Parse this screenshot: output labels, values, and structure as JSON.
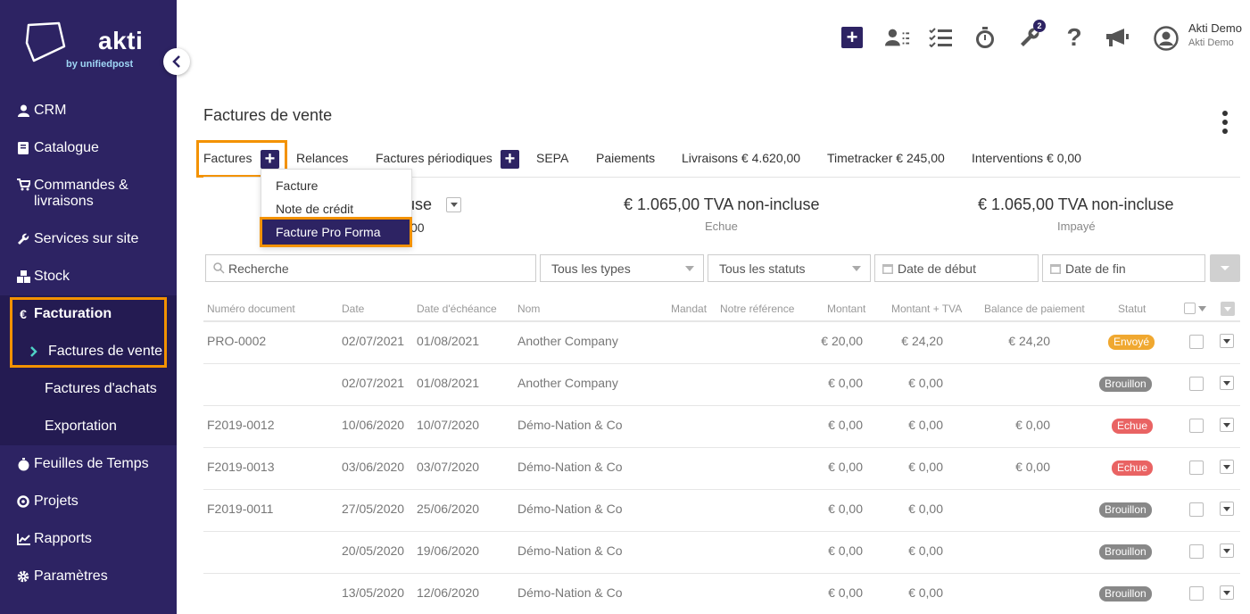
{
  "brand": {
    "name": "akti",
    "subtitle": "by unifiedpost"
  },
  "colors": {
    "sidebar": "#2d2363",
    "accent_highlight": "#f39200",
    "sent": "#f0a830",
    "draft": "#888888",
    "overdue": "#e96363"
  },
  "sidebar": {
    "items": [
      {
        "label": "CRM",
        "icon": "user-icon"
      },
      {
        "label": "Catalogue",
        "icon": "book-icon"
      },
      {
        "label": "Commandes &",
        "label2": "livraisons",
        "icon": "cart-icon"
      },
      {
        "label": "Services sur site",
        "icon": "wrench-icon"
      },
      {
        "label": "Stock",
        "icon": "boxes-icon"
      },
      {
        "label": "Facturation",
        "icon": "euro-icon"
      },
      {
        "label": "Feuilles de Temps",
        "icon": "stopwatch-icon"
      },
      {
        "label": "Projets",
        "icon": "target-icon"
      },
      {
        "label": "Rapports",
        "icon": "chart-icon"
      },
      {
        "label": "Paramètres",
        "icon": "gear-icon"
      }
    ],
    "billing_sub": [
      {
        "label": "Factures de vente"
      },
      {
        "label": "Factures d'achats"
      },
      {
        "label": "Exportation"
      }
    ]
  },
  "topbar": {
    "notifications_count": "2",
    "user_name": "Akti Demo",
    "user_org": "Akti Demo"
  },
  "page": {
    "title": "Factures de vente"
  },
  "tabs": [
    {
      "label": "Factures"
    },
    {
      "label": "Relances"
    },
    {
      "label": "Factures périodiques"
    },
    {
      "label": "SEPA"
    },
    {
      "label": "Paiements"
    },
    {
      "label": "Livraisons € 4.620,00"
    },
    {
      "label": "Timetracker € 245,00"
    },
    {
      "label": "Interventions € 0,00"
    }
  ],
  "dropdown": {
    "items": [
      "Facture",
      "Note de crédit",
      "Facture Pro Forma"
    ]
  },
  "summary": {
    "first_partial": "use",
    "first_partial_sub": "00",
    "overdue_value": "€ 1.065,00 TVA non-incluse",
    "overdue_label": "Echue",
    "unpaid_value": "€ 1.065,00 TVA non-incluse",
    "unpaid_label": "Impayé"
  },
  "filters": {
    "search_placeholder": "Recherche",
    "types": "Tous les types",
    "statuses": "Tous les statuts",
    "start_date": "Date de début",
    "end_date": "Date de fin"
  },
  "table": {
    "headers": [
      "Numéro document",
      "Date",
      "Date d'échéance",
      "Nom",
      "Mandat",
      "Notre référence",
      "Montant",
      "Montant + TVA",
      "Balance de paiement",
      "Statut"
    ],
    "rows": [
      {
        "doc": "PRO-0002",
        "date": "02/07/2021",
        "due": "01/08/2021",
        "name": "Another Company",
        "amount": "€ 20,00",
        "amount_vat": "€ 24,20",
        "balance": "€ 24,20",
        "status": "Envoyé",
        "status_type": "sent"
      },
      {
        "doc": "",
        "date": "02/07/2021",
        "due": "01/08/2021",
        "name": "Another Company",
        "amount": "€ 0,00",
        "amount_vat": "€ 0,00",
        "balance": "",
        "status": "Brouillon",
        "status_type": "draft"
      },
      {
        "doc": "F2019-0012",
        "date": "10/06/2020",
        "due": "10/07/2020",
        "name": "Démo-Nation & Co",
        "amount": "€ 0,00",
        "amount_vat": "€ 0,00",
        "balance": "€ 0,00",
        "status": "Echue",
        "status_type": "overdue"
      },
      {
        "doc": "F2019-0013",
        "date": "03/06/2020",
        "due": "03/07/2020",
        "name": "Démo-Nation & Co",
        "amount": "€ 0,00",
        "amount_vat": "€ 0,00",
        "balance": "€ 0,00",
        "status": "Echue",
        "status_type": "overdue"
      },
      {
        "doc": "F2019-0011",
        "date": "27/05/2020",
        "due": "25/06/2020",
        "name": "Démo-Nation & Co",
        "amount": "€ 0,00",
        "amount_vat": "€ 0,00",
        "balance": "",
        "status": "Brouillon",
        "status_type": "draft"
      },
      {
        "doc": "",
        "date": "20/05/2020",
        "due": "19/06/2020",
        "name": "Démo-Nation & Co",
        "amount": "€ 0,00",
        "amount_vat": "€ 0,00",
        "balance": "",
        "status": "Brouillon",
        "status_type": "draft"
      },
      {
        "doc": "",
        "date": "13/05/2020",
        "due": "12/06/2020",
        "name": "Démo-Nation & Co",
        "amount": "€ 0,00",
        "amount_vat": "€ 0,00",
        "balance": "",
        "status": "Brouillon",
        "status_type": "draft"
      }
    ]
  }
}
